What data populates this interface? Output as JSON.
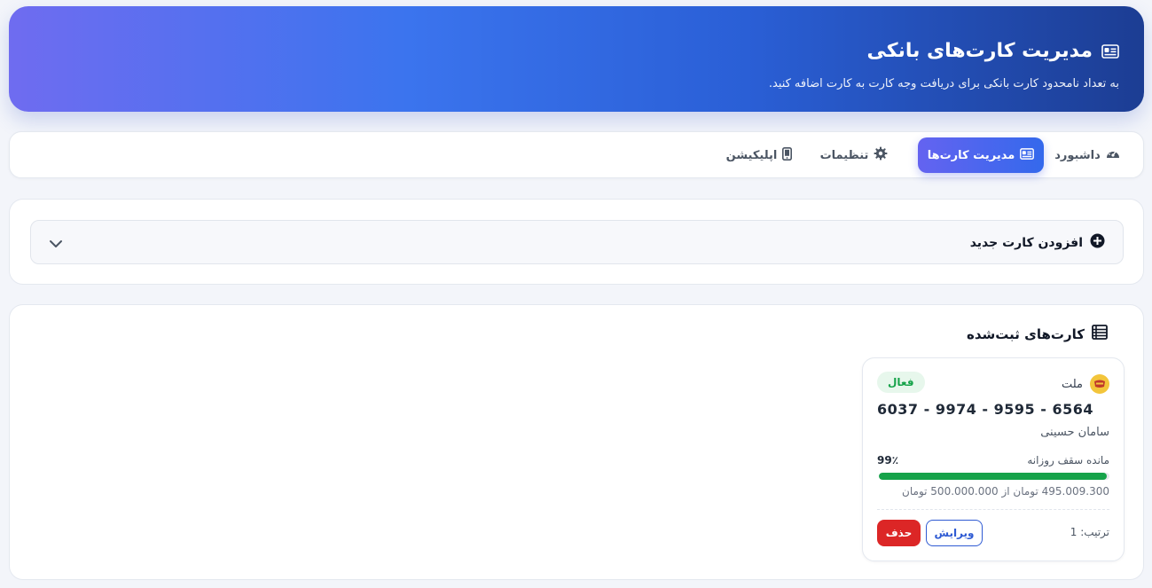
{
  "header": {
    "title": "مدیریت کارت‌های بانکی",
    "subtitle": "به تعداد نامحدود کارت بانکی برای دریافت وجه کارت به کارت اضافه کنید.",
    "icon": "id-card-icon"
  },
  "tabs": [
    {
      "label": "داشبورد",
      "icon": "gauge-icon",
      "active": false
    },
    {
      "label": "مدیریت کارت‌ها",
      "icon": "id-card-icon",
      "active": true
    },
    {
      "label": "تنظیمات",
      "icon": "gear-icon",
      "active": false
    },
    {
      "label": "اپلیکیشن",
      "icon": "mobile-icon",
      "active": false
    }
  ],
  "add_card": {
    "label": "افزودن کارت جدید",
    "icon": "plus-circle-icon",
    "toggle_icon": "chevron-down-icon"
  },
  "cards_section": {
    "title": "کارت‌های ثبت‌شده",
    "icon": "list-icon"
  },
  "cards": [
    {
      "bank": "ملت",
      "status": "فعال",
      "number": "6037 - 9974 - 9595 - 6564",
      "holder": "سامان حسینی",
      "limit_label": "مانده سقف روزانه",
      "limit_percent_text": "99٪",
      "limit_fraction": 0.99,
      "limit_detail": "495.009.300 تومان از 500.000.000 تومان",
      "order": "ترتیب: 1",
      "edit_label": "ویرایش",
      "delete_label": "حذف"
    }
  ],
  "colors": {
    "accent": "#3469ec",
    "success": "#16a34a",
    "danger": "#dc2626"
  }
}
